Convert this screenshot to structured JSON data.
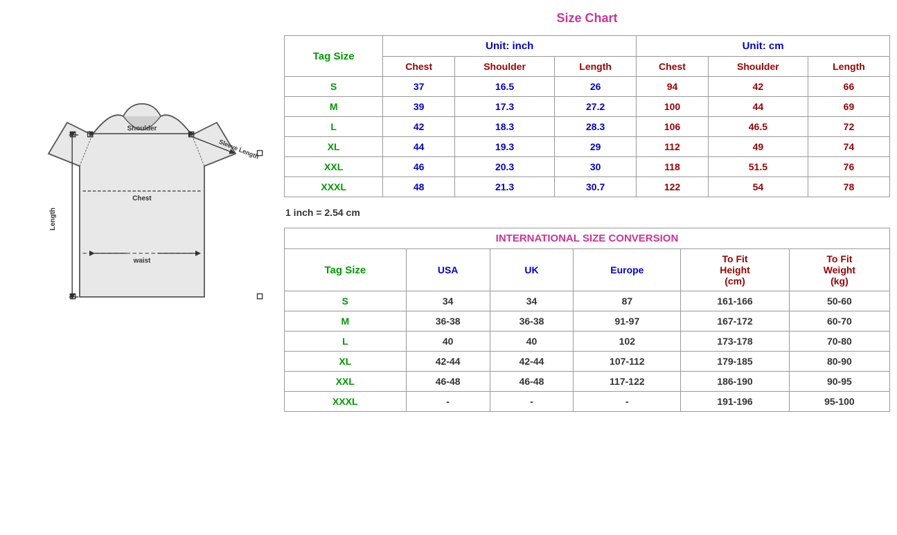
{
  "sizeChart": {
    "title": "Size Chart",
    "inchGroup": "Unit: inch",
    "cmGroup": "Unit: cm",
    "tagSizeLabel": "Tag Size",
    "inchHeaders": [
      "Chest",
      "Shoulder",
      "Length"
    ],
    "cmHeaders": [
      "Chest",
      "Shoulder",
      "Length"
    ],
    "rows": [
      {
        "tag": "S",
        "inch": {
          "chest": "37",
          "shoulder": "16.5",
          "length": "26"
        },
        "cm": {
          "chest": "94",
          "shoulder": "42",
          "length": "66"
        }
      },
      {
        "tag": "M",
        "inch": {
          "chest": "39",
          "shoulder": "17.3",
          "length": "27.2"
        },
        "cm": {
          "chest": "100",
          "shoulder": "44",
          "length": "69"
        }
      },
      {
        "tag": "L",
        "inch": {
          "chest": "42",
          "shoulder": "18.3",
          "length": "28.3"
        },
        "cm": {
          "chest": "106",
          "shoulder": "46.5",
          "length": "72"
        }
      },
      {
        "tag": "XL",
        "inch": {
          "chest": "44",
          "shoulder": "19.3",
          "length": "29"
        },
        "cm": {
          "chest": "112",
          "shoulder": "49",
          "length": "74"
        }
      },
      {
        "tag": "XXL",
        "inch": {
          "chest": "46",
          "shoulder": "20.3",
          "length": "30"
        },
        "cm": {
          "chest": "118",
          "shoulder": "51.5",
          "length": "76"
        }
      },
      {
        "tag": "XXXL",
        "inch": {
          "chest": "48",
          "shoulder": "21.3",
          "length": "30.7"
        },
        "cm": {
          "chest": "122",
          "shoulder": "54",
          "length": "78"
        }
      }
    ],
    "inchNote": "1 inch = 2.54 cm"
  },
  "intlConversion": {
    "title": "INTERNATIONAL SIZE CONVERSION",
    "tagSizeLabel": "Tag Size",
    "headers": [
      "USA",
      "UK",
      "Europe",
      "To Fit Height (cm)",
      "To Fit Weight (kg)"
    ],
    "rows": [
      {
        "tag": "S",
        "usa": "34",
        "uk": "34",
        "europe": "87",
        "height": "161-166",
        "weight": "50-60"
      },
      {
        "tag": "M",
        "usa": "36-38",
        "uk": "36-38",
        "europe": "91-97",
        "height": "167-172",
        "weight": "60-70"
      },
      {
        "tag": "L",
        "usa": "40",
        "uk": "40",
        "europe": "102",
        "height": "173-178",
        "weight": "70-80"
      },
      {
        "tag": "XL",
        "usa": "42-44",
        "uk": "42-44",
        "europe": "107-112",
        "height": "179-185",
        "weight": "80-90"
      },
      {
        "tag": "XXL",
        "usa": "46-48",
        "uk": "46-48",
        "europe": "117-122",
        "height": "186-190",
        "weight": "90-95"
      },
      {
        "tag": "XXXL",
        "usa": "-",
        "uk": "-",
        "europe": "-",
        "height": "191-196",
        "weight": "95-100"
      }
    ]
  },
  "diagram": {
    "labels": {
      "shoulder": "Shoulder",
      "sleeveLength": "Sleeve Length",
      "chest": "Chest",
      "length": "Length",
      "waist": "waist"
    }
  }
}
